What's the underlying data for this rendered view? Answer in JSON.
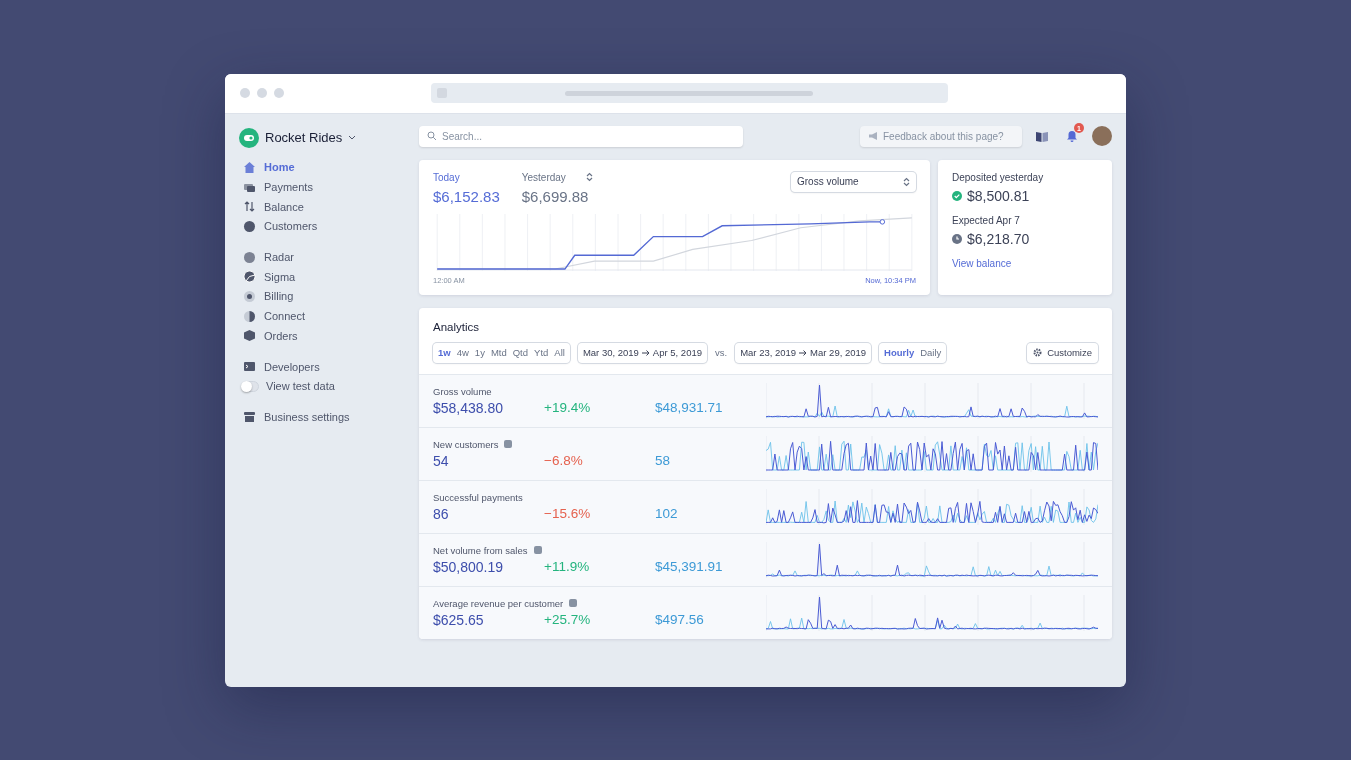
{
  "account": {
    "name": "Rocket Rides"
  },
  "nav": [
    [
      {
        "kind": "link",
        "label": "Home",
        "selected": true
      },
      {
        "kind": "link",
        "label": "Payments",
        "selected": false
      },
      {
        "kind": "link",
        "label": "Balance",
        "selected": false
      },
      {
        "kind": "link",
        "label": "Customers",
        "selected": false
      }
    ],
    [
      {
        "kind": "link",
        "label": "Radar",
        "selected": false
      },
      {
        "kind": "link",
        "label": "Sigma",
        "selected": false
      },
      {
        "kind": "link",
        "label": "Billing",
        "selected": false
      },
      {
        "kind": "link",
        "label": "Connect",
        "selected": false
      },
      {
        "kind": "link",
        "label": "Orders",
        "selected": false
      }
    ],
    [
      {
        "kind": "link",
        "label": "Developers",
        "selected": false
      },
      {
        "kind": "toggle",
        "label": "View test data",
        "on": false
      }
    ],
    [
      {
        "kind": "link",
        "label": "Business settings",
        "selected": false
      }
    ]
  ],
  "search": {
    "placeholder": "Search..."
  },
  "feedback": {
    "placeholder": "Feedback about this page?"
  },
  "notifications": {
    "count": "1"
  },
  "today": {
    "periods": [
      {
        "label": "Today",
        "value": "$6,152.83",
        "selected": true
      },
      {
        "label": "Yesterday",
        "value": "$6,699.88",
        "selected": false
      }
    ],
    "metric": "Gross volume",
    "start_label": "12:00 AM",
    "end_label": "Now, 10:34 PM"
  },
  "payouts": [
    {
      "kind": "done",
      "label": "Deposited yesterday",
      "amount": "$8,500.81"
    },
    {
      "kind": "pending",
      "label": "Expected Apr 7",
      "amount": "$6,218.70"
    }
  ],
  "payouts_link": "View balance",
  "analytics": {
    "title": "Analytics",
    "ranges": [
      {
        "label": "1w",
        "selected": true
      },
      {
        "label": "4w",
        "selected": false
      },
      {
        "label": "1y",
        "selected": false
      },
      {
        "label": "Mtd",
        "selected": false
      },
      {
        "label": "Qtd",
        "selected": false
      },
      {
        "label": "Ytd",
        "selected": false
      },
      {
        "label": "All",
        "selected": false
      }
    ],
    "period": {
      "start": "Mar 30, 2019",
      "end": "Apr 5, 2019"
    },
    "vs": "vs.",
    "compare": {
      "start": "Mar 23, 2019",
      "end": "Mar 29, 2019"
    },
    "granularity": [
      {
        "label": "Hourly",
        "selected": true
      },
      {
        "label": "Daily",
        "selected": false
      }
    ],
    "customize": "Customize",
    "metrics": [
      {
        "label": "Gross volume",
        "info": false,
        "value": "$58,438.80",
        "change": "+19.4%",
        "positive": true,
        "previous": "$48,931.71"
      },
      {
        "label": "New customers",
        "info": true,
        "value": "54",
        "change": "−6.8%",
        "positive": false,
        "previous": "58"
      },
      {
        "label": "Successful payments",
        "info": false,
        "value": "86",
        "change": "−15.6%",
        "positive": false,
        "previous": "102"
      },
      {
        "label": "Net volume from sales",
        "info": true,
        "value": "$50,800.19",
        "change": "+11.9%",
        "positive": true,
        "previous": "$45,391.91"
      },
      {
        "label": "Average revenue per customer",
        "info": true,
        "value": "$625.65",
        "change": "+25.7%",
        "positive": true,
        "previous": "$497.56"
      }
    ]
  }
}
